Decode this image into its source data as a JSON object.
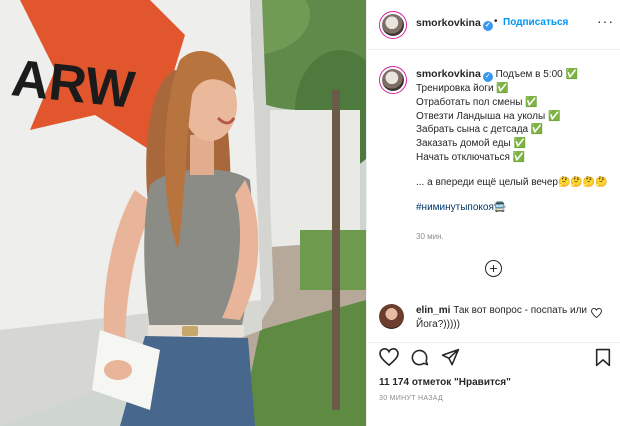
{
  "post": {
    "username": "smorkovkina",
    "follow_label": "Подписаться",
    "separator": "•",
    "more_label": "···",
    "verified_mark": "✓"
  },
  "caption": {
    "username": "smorkovkina",
    "lines": [
      "Подъем в 5:00 ✅",
      "Тренировка йоги ✅",
      "Отработать пол смены ✅",
      "Отвезти Ландыша на уколы ✅",
      "Забрать сына с детсада ✅",
      "Заказать домой еды ✅",
      "Начать отключаться ✅"
    ],
    "closing": "... а впереди ещё целый вечер🤔🤔🤔🤔",
    "hashtag": "#ниминутыпокоя🚍",
    "time": "30 мин."
  },
  "load_more": "+",
  "comment": {
    "username": "elin_mi",
    "text": "Так вот вопрос - поспать или Йога?)))))"
  },
  "likes_text": "11 174 отметок \"Нравится\"",
  "posted_ago": "30 МИНУТ НАЗАД",
  "photo": {
    "truck_sign": "ARW"
  },
  "icons": [
    "heart-icon",
    "comment-icon",
    "share-icon",
    "bookmark-icon",
    "plus-circle-icon",
    "verified-icon",
    "more-icon"
  ],
  "colors": {
    "accent": "#0095f6",
    "verified": "#3897f0",
    "text": "#262626",
    "muted": "#8e8e8e",
    "hashtag": "#00376b",
    "truck_red": "#e2562e"
  }
}
